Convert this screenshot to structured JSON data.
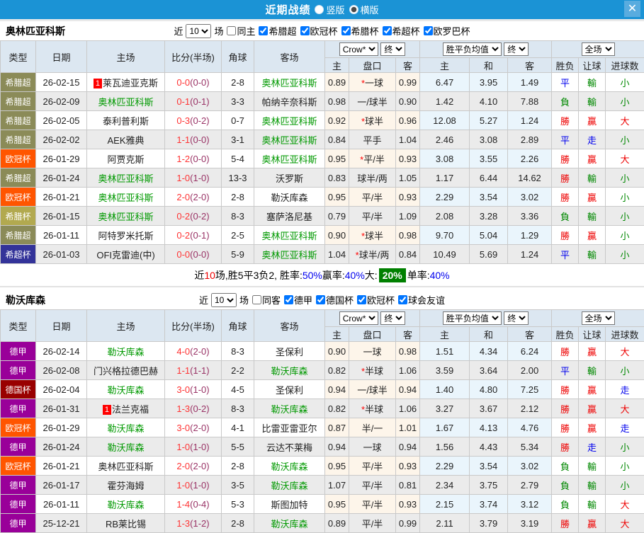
{
  "titlebar": {
    "title": "近期战绩",
    "vertical_label": "竖版",
    "horizontal_label": "横版",
    "selected_layout": "横版",
    "close_icon": "✕",
    "bar_color": "#1b93d5"
  },
  "cols": {
    "type": "类型",
    "date": "日期",
    "home": "主场",
    "score": "比分(半场)",
    "corner": "角球",
    "away": "客场",
    "company": "Crow*",
    "final_a": "终",
    "wdl_avg": "胜平负均值",
    "final_b": "终",
    "fulltime": "全场",
    "sub_home": "主",
    "sub_handicap": "盘口",
    "sub_away": "客",
    "sub_win": "主",
    "sub_draw": "和",
    "sub_lose": "客",
    "sub_result": "胜负",
    "sub_handicap_result": "让球",
    "sub_goals": "进球数"
  },
  "type_colors": {
    "希腊超": "#8b8b58",
    "欧冠杯": "#ff5500",
    "希腊杯": "#b2a94f",
    "希超杯": "#333399",
    "德甲": "#990099",
    "德国杯": "#990000"
  },
  "result_colors": {
    "勝": "#ee0000",
    "贏": "#ee0000",
    "大": "#ee0000",
    "負": "#008800",
    "輸": "#008800",
    "小": "#008800",
    "平": "#0000ee",
    "走": "#0000ee"
  },
  "sections": [
    {
      "filter": {
        "team": "奥林匹亚科斯",
        "near": "近",
        "count": "10",
        "games": "场",
        "same": "同主",
        "same_checked": false,
        "comps": [
          "希腊超",
          "欧冠杯",
          "希腊杯",
          "希超杯",
          "欧罗巴杯"
        ],
        "comps_checked": true
      },
      "rows": [
        {
          "type": "希腊超",
          "date": "26-02-15",
          "home": "莱瓦迪亚克斯",
          "home_rank": "1",
          "ft": "0-0",
          "ht": "(0-0)",
          "corner": "2-8",
          "away": "奥林匹亚科斯",
          "away_green": true,
          "o1": "0.89",
          "handicap": "*一球",
          "o2": "0.99",
          "w": "6.47",
          "d": "3.95",
          "l": "1.49",
          "res": "平",
          "hres": "輸",
          "gres": "小"
        },
        {
          "type": "希腊超",
          "date": "26-02-09",
          "home": "奥林匹亚科斯",
          "home_green": true,
          "ft": "0-1",
          "ht": "(0-1)",
          "corner": "3-3",
          "away": "帕纳辛奈科斯",
          "o1": "0.98",
          "handicap": "一/球半",
          "o2": "0.90",
          "w": "1.42",
          "d": "4.10",
          "l": "7.88",
          "res": "負",
          "hres": "輸",
          "gres": "小"
        },
        {
          "type": "希腊超",
          "date": "26-02-05",
          "home": "泰利普利斯",
          "ft": "0-3",
          "ht": "(0-2)",
          "corner": "0-7",
          "away": "奥林匹亚科斯",
          "away_green": true,
          "o1": "0.92",
          "handicap": "*球半",
          "o2": "0.96",
          "w": "12.08",
          "d": "5.27",
          "l": "1.24",
          "res": "勝",
          "hres": "贏",
          "gres": "大"
        },
        {
          "type": "希腊超",
          "date": "26-02-02",
          "home": "AEK雅典",
          "ft": "1-1",
          "ht": "(0-0)",
          "corner": "3-1",
          "away": "奥林匹亚科斯",
          "away_green": true,
          "o1": "0.84",
          "handicap": "平手",
          "o2": "1.04",
          "w": "2.46",
          "d": "3.08",
          "l": "2.89",
          "res": "平",
          "hres": "走",
          "gres": "小"
        },
        {
          "type": "欧冠杯",
          "date": "26-01-29",
          "home": "阿贾克斯",
          "ft": "1-2",
          "ht": "(0-0)",
          "corner": "5-4",
          "away": "奥林匹亚科斯",
          "away_green": true,
          "o1": "0.95",
          "handicap": "*平/半",
          "o2": "0.93",
          "w": "3.08",
          "d": "3.55",
          "l": "2.26",
          "res": "勝",
          "hres": "贏",
          "gres": "大"
        },
        {
          "type": "希腊超",
          "date": "26-01-24",
          "home": "奥林匹亚科斯",
          "home_green": true,
          "ft": "1-0",
          "ht": "(1-0)",
          "corner": "13-3",
          "away": "沃罗斯",
          "o1": "0.83",
          "handicap": "球半/两",
          "o2": "1.05",
          "w": "1.17",
          "d": "6.44",
          "l": "14.62",
          "res": "勝",
          "hres": "輸",
          "gres": "小"
        },
        {
          "type": "欧冠杯",
          "date": "26-01-21",
          "home": "奥林匹亚科斯",
          "home_green": true,
          "ft": "2-0",
          "ht": "(2-0)",
          "corner": "2-8",
          "away": "勒沃库森",
          "o1": "0.95",
          "handicap": "平/半",
          "o2": "0.93",
          "w": "2.29",
          "d": "3.54",
          "l": "3.02",
          "res": "勝",
          "hres": "贏",
          "gres": "小"
        },
        {
          "type": "希腊杯",
          "date": "26-01-15",
          "home": "奥林匹亚科斯",
          "home_green": true,
          "ft": "0-2",
          "ht": "(0-2)",
          "corner": "8-3",
          "away": "塞萨洛尼基",
          "o1": "0.79",
          "handicap": "平/半",
          "o2": "1.09",
          "w": "2.08",
          "d": "3.28",
          "l": "3.36",
          "res": "負",
          "hres": "輸",
          "gres": "小"
        },
        {
          "type": "希腊超",
          "date": "26-01-11",
          "home": "阿特罗米托斯",
          "ft": "0-2",
          "ht": "(0-1)",
          "corner": "2-5",
          "away": "奥林匹亚科斯",
          "away_green": true,
          "o1": "0.90",
          "handicap": "*球半",
          "o2": "0.98",
          "w": "9.70",
          "d": "5.04",
          "l": "1.29",
          "res": "勝",
          "hres": "贏",
          "gres": "小"
        },
        {
          "type": "希超杯",
          "date": "26-01-03",
          "home": "OFI克雷迪(中)",
          "ft": "0-0",
          "ht": "(0-0)",
          "corner": "5-9",
          "away": "奥林匹亚科斯",
          "away_green": true,
          "o1": "1.04",
          "handicap": "*球半/两",
          "o2": "0.84",
          "w": "10.49",
          "d": "5.69",
          "l": "1.24",
          "res": "平",
          "hres": "輸",
          "gres": "小"
        }
      ],
      "summary": {
        "parts": [
          {
            "text": "近",
            "color": "black"
          },
          {
            "text": "10",
            "color": "red"
          },
          {
            "text": "场,胜5平3负2, 胜率:",
            "color": "black"
          },
          {
            "text": "50%",
            "color": "blue"
          },
          {
            "text": " 赢率:",
            "color": "black"
          },
          {
            "text": "40%",
            "color": "blue"
          },
          {
            "text": " 大:",
            "color": "black"
          },
          {
            "text": "20%",
            "color": "badge"
          },
          {
            "text": " 单率:",
            "color": "black"
          },
          {
            "text": "40%",
            "color": "blue"
          }
        ]
      }
    },
    {
      "filter": {
        "team": "勒沃库森",
        "near": "近",
        "count": "10",
        "games": "场",
        "same": "同客",
        "same_checked": false,
        "comps": [
          "德甲",
          "德国杯",
          "欧冠杯",
          "球会友谊"
        ],
        "comps_checked": true
      },
      "rows": [
        {
          "type": "德甲",
          "date": "26-02-14",
          "home": "勒沃库森",
          "home_green": true,
          "ft": "4-0",
          "ht": "(2-0)",
          "corner": "8-3",
          "away": "圣保利",
          "o1": "0.90",
          "handicap": "一球",
          "o2": "0.98",
          "w": "1.51",
          "d": "4.34",
          "l": "6.24",
          "res": "勝",
          "hres": "贏",
          "gres": "大"
        },
        {
          "type": "德甲",
          "date": "26-02-08",
          "home": "门兴格拉德巴赫",
          "ft": "1-1",
          "ht": "(1-1)",
          "corner": "2-2",
          "away": "勒沃库森",
          "away_green": true,
          "o1": "0.82",
          "handicap": "*半球",
          "o2": "1.06",
          "w": "3.59",
          "d": "3.64",
          "l": "2.00",
          "res": "平",
          "hres": "輸",
          "gres": "小"
        },
        {
          "type": "德国杯",
          "date": "26-02-04",
          "home": "勒沃库森",
          "home_green": true,
          "ft": "3-0",
          "ht": "(1-0)",
          "corner": "4-5",
          "away": "圣保利",
          "o1": "0.94",
          "handicap": "一/球半",
          "o2": "0.94",
          "w": "1.40",
          "d": "4.80",
          "l": "7.25",
          "res": "勝",
          "hres": "贏",
          "gres": "走"
        },
        {
          "type": "德甲",
          "date": "26-01-31",
          "home": "法兰克福",
          "home_rank": "1",
          "ft": "1-3",
          "ht": "(0-2)",
          "corner": "8-3",
          "away": "勒沃库森",
          "away_green": true,
          "o1": "0.82",
          "handicap": "*半球",
          "o2": "1.06",
          "w": "3.27",
          "d": "3.67",
          "l": "2.12",
          "res": "勝",
          "hres": "贏",
          "gres": "大"
        },
        {
          "type": "欧冠杯",
          "date": "26-01-29",
          "home": "勒沃库森",
          "home_green": true,
          "ft": "3-0",
          "ht": "(2-0)",
          "corner": "4-1",
          "away": "比雷亚雷亚尔",
          "o1": "0.87",
          "handicap": "半/一",
          "o2": "1.01",
          "w": "1.67",
          "d": "4.13",
          "l": "4.76",
          "res": "勝",
          "hres": "贏",
          "gres": "走"
        },
        {
          "type": "德甲",
          "date": "26-01-24",
          "home": "勒沃库森",
          "home_green": true,
          "ft": "1-0",
          "ht": "(1-0)",
          "corner": "5-5",
          "away": "云达不莱梅",
          "o1": "0.94",
          "handicap": "一球",
          "o2": "0.94",
          "w": "1.56",
          "d": "4.43",
          "l": "5.34",
          "res": "勝",
          "hres": "走",
          "gres": "小"
        },
        {
          "type": "欧冠杯",
          "date": "26-01-21",
          "home": "奥林匹亚科斯",
          "ft": "2-0",
          "ht": "(2-0)",
          "corner": "2-8",
          "away": "勒沃库森",
          "away_green": true,
          "o1": "0.95",
          "handicap": "平/半",
          "o2": "0.93",
          "w": "2.29",
          "d": "3.54",
          "l": "3.02",
          "res": "負",
          "hres": "輸",
          "gres": "小"
        },
        {
          "type": "德甲",
          "date": "26-01-17",
          "home": "霍芬海姆",
          "ft": "1-0",
          "ht": "(1-0)",
          "corner": "3-5",
          "away": "勒沃库森",
          "away_green": true,
          "o1": "1.07",
          "handicap": "平/半",
          "o2": "0.81",
          "w": "2.34",
          "d": "3.75",
          "l": "2.79",
          "res": "負",
          "hres": "輸",
          "gres": "小"
        },
        {
          "type": "德甲",
          "date": "26-01-11",
          "home": "勒沃库森",
          "home_green": true,
          "ft": "1-4",
          "ht": "(0-4)",
          "corner": "5-3",
          "away": "斯图加特",
          "o1": "0.95",
          "handicap": "平/半",
          "o2": "0.93",
          "w": "2.15",
          "d": "3.74",
          "l": "3.12",
          "res": "負",
          "hres": "輸",
          "gres": "大"
        },
        {
          "type": "德甲",
          "date": "25-12-21",
          "home": "RB莱比锡",
          "ft": "1-3",
          "ht": "(1-2)",
          "corner": "2-8",
          "away": "勒沃库森",
          "away_green": true,
          "o1": "0.89",
          "handicap": "平/半",
          "o2": "0.99",
          "w": "2.11",
          "d": "3.79",
          "l": "3.19",
          "res": "勝",
          "hres": "贏",
          "gres": "大"
        }
      ],
      "summary": null
    }
  ]
}
